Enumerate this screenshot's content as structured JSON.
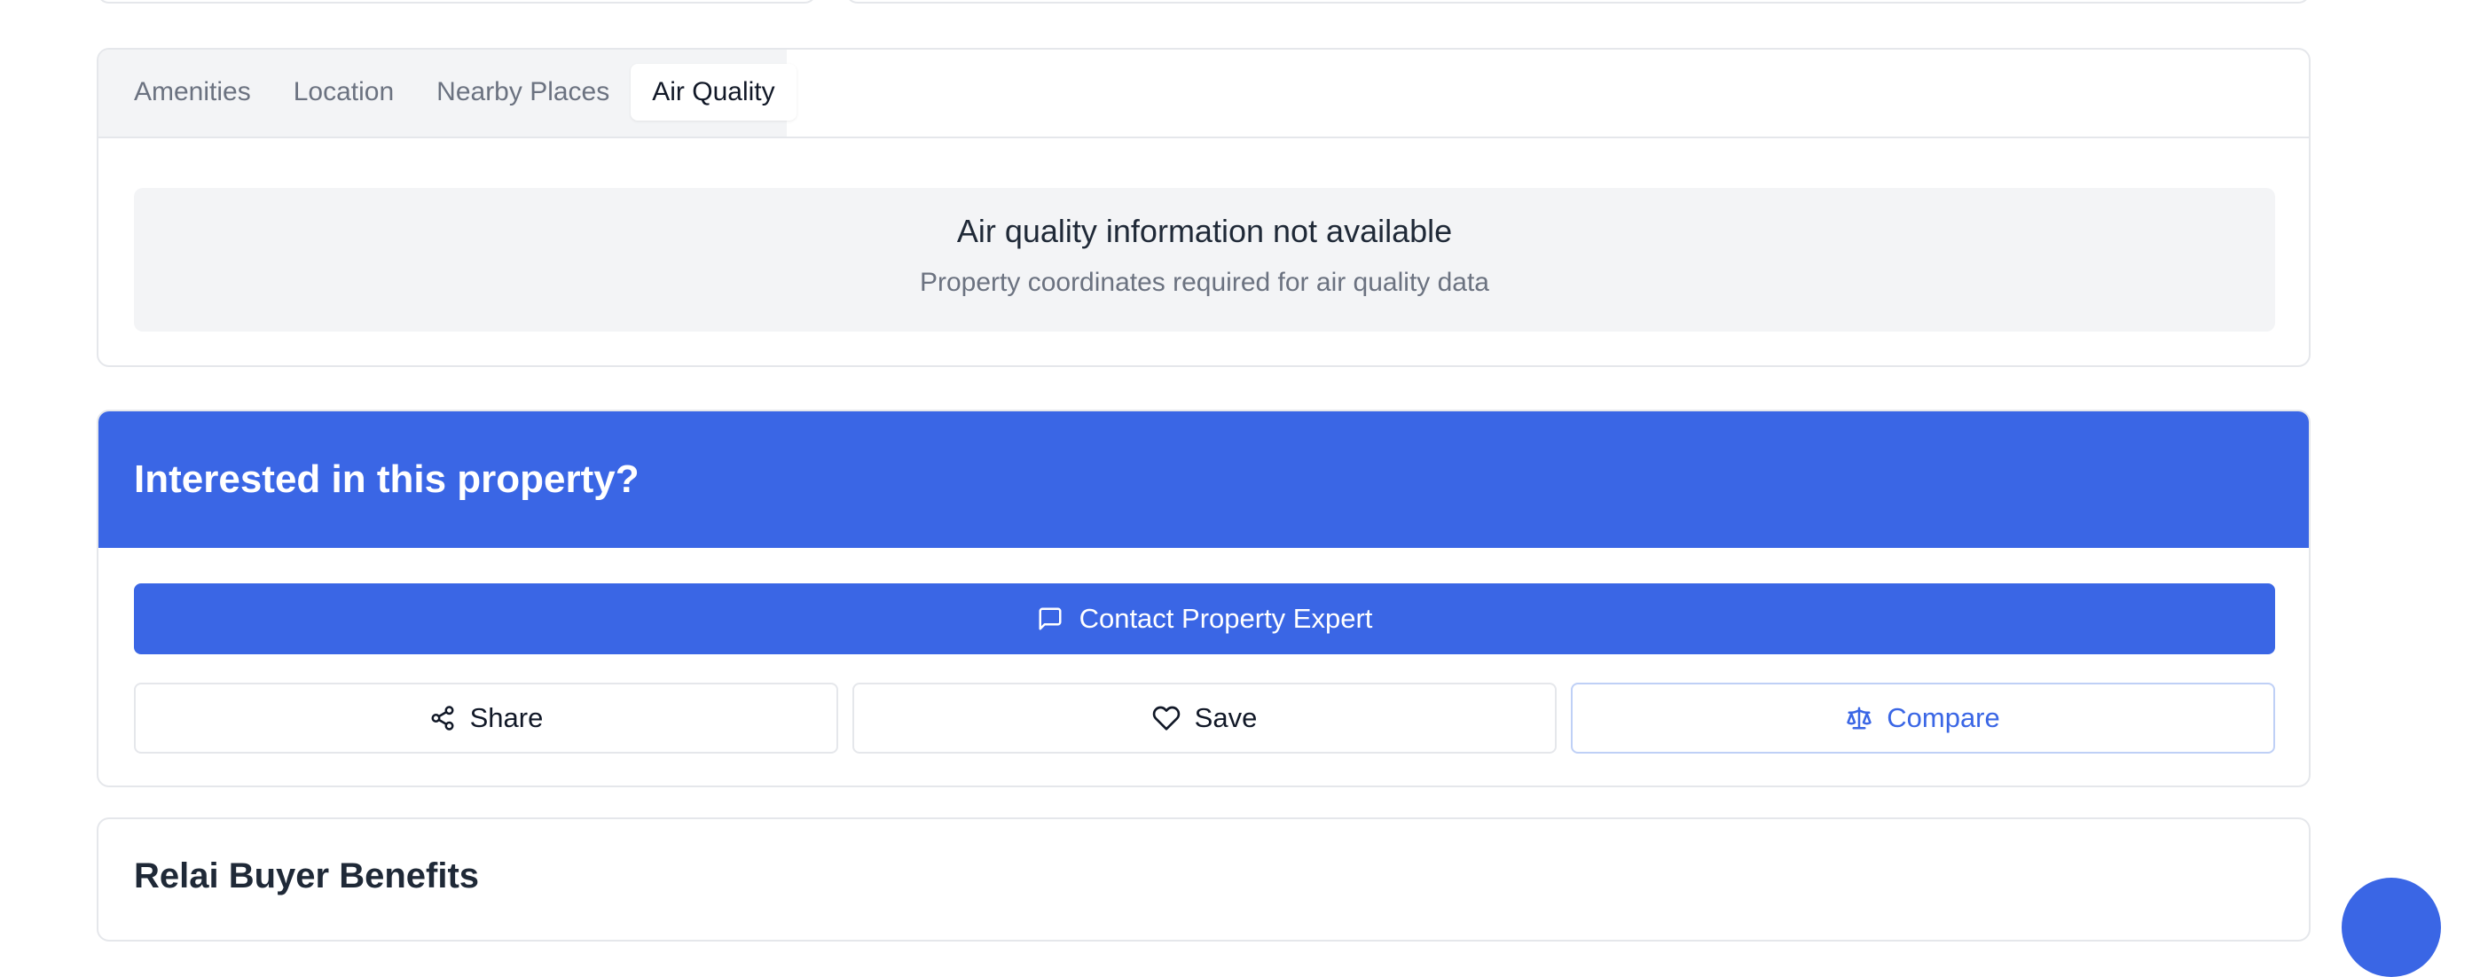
{
  "tabs": [
    {
      "label": "Amenities",
      "active": false
    },
    {
      "label": "Location",
      "active": false
    },
    {
      "label": "Nearby Places",
      "active": false
    },
    {
      "label": "Air Quality",
      "active": true
    }
  ],
  "air_quality": {
    "title": "Air quality information not available",
    "subtitle": "Property coordinates required for air quality data"
  },
  "interest": {
    "title": "Interested in this property?",
    "contact_label": "Contact Property Expert",
    "contact_icon": "message-square-icon",
    "actions": [
      {
        "label": "Share",
        "icon": "share-icon"
      },
      {
        "label": "Save",
        "icon": "heart-icon"
      },
      {
        "label": "Compare",
        "icon": "scale-icon"
      }
    ]
  },
  "benefits": {
    "title": "Relai Buyer Benefits"
  },
  "colors": {
    "primary": "#3a66e5",
    "tab_bg": "#f3f4f6",
    "border": "#e5e7eb",
    "muted_text": "#6b7280"
  }
}
